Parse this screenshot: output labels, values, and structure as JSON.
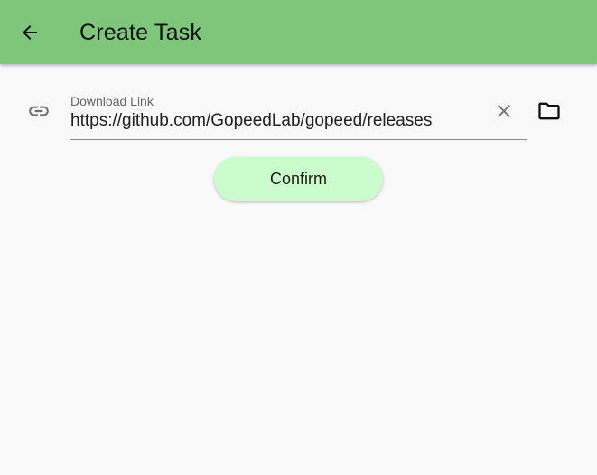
{
  "app_bar": {
    "title": "Create Task",
    "back_icon": "arrow-back-icon",
    "color": "#7dc67a"
  },
  "form": {
    "link_icon": "link-icon",
    "url_field": {
      "label": "Download Link",
      "value": "https://github.com/GopeedLab/gopeed/releases"
    },
    "clear_icon": "close-icon",
    "folder_icon": "folder-icon"
  },
  "confirm_button": {
    "label": "Confirm",
    "color": "#cbfccb"
  }
}
